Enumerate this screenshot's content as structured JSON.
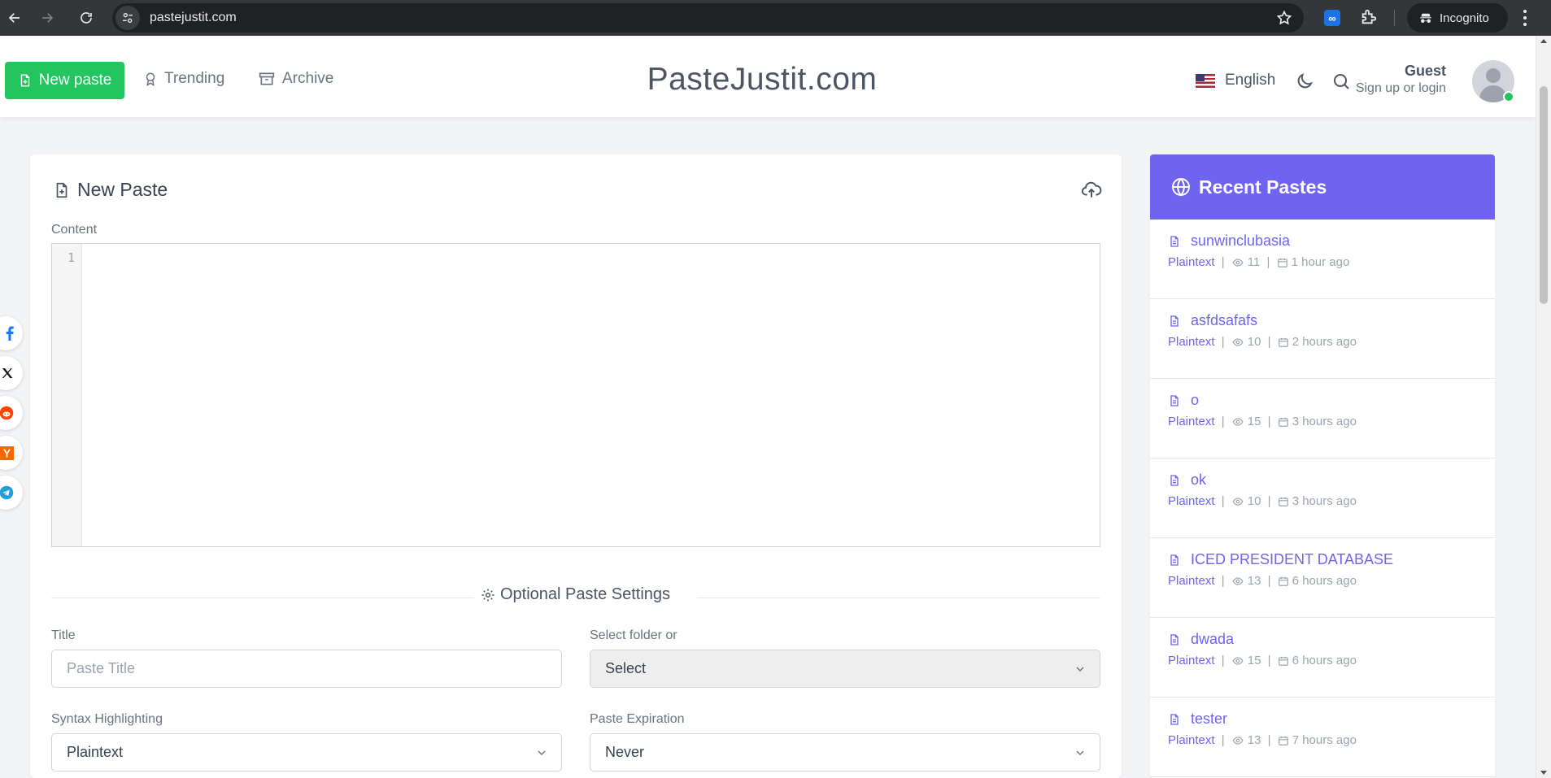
{
  "browser": {
    "url": "pastejustit.com",
    "incognito_label": "Incognito"
  },
  "header": {
    "new_paste_label": "New paste",
    "trending_label": "Trending",
    "archive_label": "Archive",
    "brand": "PasteJustit.com",
    "language": "English",
    "user_name": "Guest",
    "user_sub": "Sign up or login"
  },
  "social": [
    "facebook-icon",
    "x-icon",
    "reddit-icon",
    "hackernews-icon",
    "telegram-icon"
  ],
  "editor_card": {
    "title": "New Paste",
    "content_label": "Content",
    "line_number": "1",
    "settings_title": "Optional Paste Settings",
    "title_label": "Title",
    "title_placeholder": "Paste Title",
    "folder_label": "Select folder or",
    "folder_value": "Select",
    "syntax_label": "Syntax Highlighting",
    "syntax_value": "Plaintext",
    "expiration_label": "Paste Expiration",
    "expiration_value": "Never"
  },
  "recent": {
    "title": "Recent Pastes",
    "items": [
      {
        "title": "sunwinclubasia",
        "syntax": "Plaintext",
        "views": "11",
        "time": "1 hour ago"
      },
      {
        "title": "asfdsafafs",
        "syntax": "Plaintext",
        "views": "10",
        "time": "2 hours ago"
      },
      {
        "title": "o",
        "syntax": "Plaintext",
        "views": "15",
        "time": "3 hours ago"
      },
      {
        "title": "ok",
        "syntax": "Plaintext",
        "views": "10",
        "time": "3 hours ago"
      },
      {
        "title": "ICED PRESIDENT DATABASE",
        "syntax": "Plaintext",
        "views": "13",
        "time": "6 hours ago"
      },
      {
        "title": "dwada",
        "syntax": "Plaintext",
        "views": "15",
        "time": "6 hours ago"
      },
      {
        "title": "tester",
        "syntax": "Plaintext",
        "views": "13",
        "time": "7 hours ago"
      }
    ]
  },
  "colors": {
    "accent_green": "#22c55e",
    "accent_purple": "#6e64f0",
    "chrome_dark": "#35363a"
  }
}
